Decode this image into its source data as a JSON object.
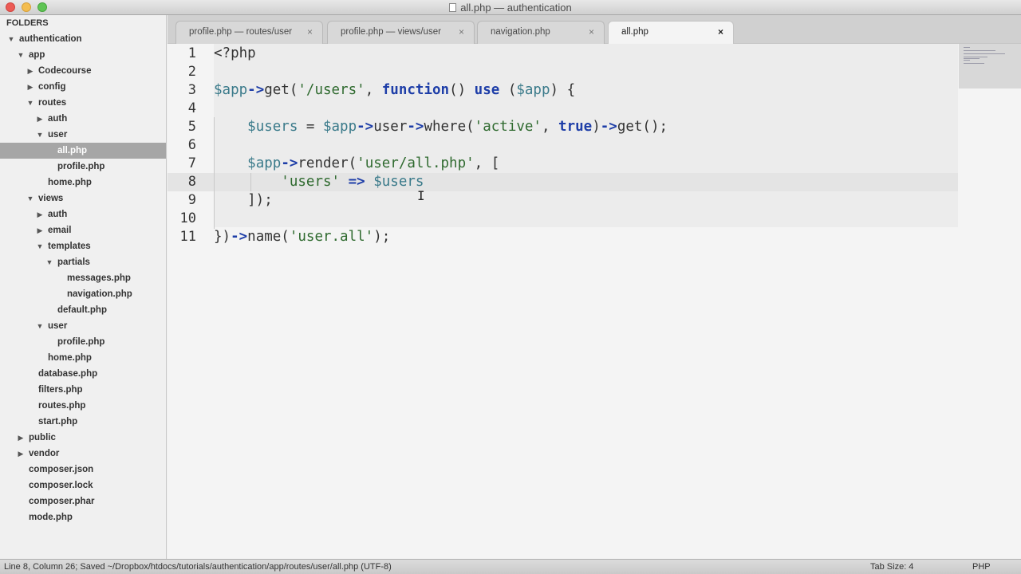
{
  "window": {
    "title": "all.php — authentication"
  },
  "sidebar": {
    "header": "FOLDERS",
    "items": [
      {
        "label": "authentication",
        "depth": 0,
        "arrow": "▼"
      },
      {
        "label": "app",
        "depth": 1,
        "arrow": "▼"
      },
      {
        "label": "Codecourse",
        "depth": 2,
        "arrow": "▶"
      },
      {
        "label": "config",
        "depth": 2,
        "arrow": "▶"
      },
      {
        "label": "routes",
        "depth": 2,
        "arrow": "▼"
      },
      {
        "label": "auth",
        "depth": 3,
        "arrow": "▶"
      },
      {
        "label": "user",
        "depth": 3,
        "arrow": "▼"
      },
      {
        "label": "all.php",
        "depth": 4,
        "arrow": "",
        "selected": true
      },
      {
        "label": "profile.php",
        "depth": 4,
        "arrow": ""
      },
      {
        "label": "home.php",
        "depth": 3,
        "arrow": ""
      },
      {
        "label": "views",
        "depth": 2,
        "arrow": "▼"
      },
      {
        "label": "auth",
        "depth": 3,
        "arrow": "▶"
      },
      {
        "label": "email",
        "depth": 3,
        "arrow": "▶"
      },
      {
        "label": "templates",
        "depth": 3,
        "arrow": "▼"
      },
      {
        "label": "partials",
        "depth": 4,
        "arrow": "▼"
      },
      {
        "label": "messages.php",
        "depth": 5,
        "arrow": ""
      },
      {
        "label": "navigation.php",
        "depth": 5,
        "arrow": ""
      },
      {
        "label": "default.php",
        "depth": 4,
        "arrow": ""
      },
      {
        "label": "user",
        "depth": 3,
        "arrow": "▼"
      },
      {
        "label": "profile.php",
        "depth": 4,
        "arrow": ""
      },
      {
        "label": "home.php",
        "depth": 3,
        "arrow": ""
      },
      {
        "label": "database.php",
        "depth": 2,
        "arrow": ""
      },
      {
        "label": "filters.php",
        "depth": 2,
        "arrow": ""
      },
      {
        "label": "routes.php",
        "depth": 2,
        "arrow": ""
      },
      {
        "label": "start.php",
        "depth": 2,
        "arrow": ""
      },
      {
        "label": "public",
        "depth": 1,
        "arrow": "▶"
      },
      {
        "label": "vendor",
        "depth": 1,
        "arrow": "▶"
      },
      {
        "label": "composer.json",
        "depth": 1,
        "arrow": ""
      },
      {
        "label": "composer.lock",
        "depth": 1,
        "arrow": ""
      },
      {
        "label": "composer.phar",
        "depth": 1,
        "arrow": ""
      },
      {
        "label": "mode.php",
        "depth": 1,
        "arrow": ""
      }
    ]
  },
  "tabs": [
    {
      "label": "profile.php — routes/user",
      "close": "×",
      "active": false
    },
    {
      "label": "profile.php — views/user",
      "close": "×",
      "active": false
    },
    {
      "label": "navigation.php",
      "close": "×",
      "active": false
    },
    {
      "label": "all.php",
      "close": "×",
      "active": true
    }
  ],
  "editor": {
    "line_numbers": [
      "1",
      "2",
      "3",
      "4",
      "5",
      "6",
      "7",
      "8",
      "9",
      "10",
      "11"
    ],
    "lines": [
      [
        {
          "t": "<?php",
          "c": "fn"
        }
      ],
      [],
      [
        {
          "t": "$app",
          "c": "var"
        },
        {
          "t": "->",
          "c": "op"
        },
        {
          "t": "get(",
          "c": "fn"
        },
        {
          "t": "'/users'",
          "c": "str"
        },
        {
          "t": ", ",
          "c": "fn"
        },
        {
          "t": "function",
          "c": "kw"
        },
        {
          "t": "() ",
          "c": "fn"
        },
        {
          "t": "use",
          "c": "kw"
        },
        {
          "t": " (",
          "c": "fn"
        },
        {
          "t": "$app",
          "c": "var"
        },
        {
          "t": ") {",
          "c": "fn"
        }
      ],
      [],
      [
        {
          "t": "    ",
          "c": "fn"
        },
        {
          "t": "$users",
          "c": "var"
        },
        {
          "t": " = ",
          "c": "fn"
        },
        {
          "t": "$app",
          "c": "var"
        },
        {
          "t": "->",
          "c": "op"
        },
        {
          "t": "user",
          "c": "fn"
        },
        {
          "t": "->",
          "c": "op"
        },
        {
          "t": "where(",
          "c": "fn"
        },
        {
          "t": "'active'",
          "c": "str"
        },
        {
          "t": ", ",
          "c": "fn"
        },
        {
          "t": "true",
          "c": "kw"
        },
        {
          "t": ")",
          "c": "fn"
        },
        {
          "t": "->",
          "c": "op"
        },
        {
          "t": "get();",
          "c": "fn"
        }
      ],
      [],
      [
        {
          "t": "    ",
          "c": "fn"
        },
        {
          "t": "$app",
          "c": "var"
        },
        {
          "t": "->",
          "c": "op"
        },
        {
          "t": "render(",
          "c": "fn"
        },
        {
          "t": "'user/all.php'",
          "c": "str"
        },
        {
          "t": ", [",
          "c": "fn"
        }
      ],
      [
        {
          "t": "        ",
          "c": "fn"
        },
        {
          "t": "'users'",
          "c": "str"
        },
        {
          "t": " ",
          "c": "fn"
        },
        {
          "t": "=>",
          "c": "op"
        },
        {
          "t": " ",
          "c": "fn"
        },
        {
          "t": "$users",
          "c": "var"
        }
      ],
      [
        {
          "t": "    ]);",
          "c": "fn"
        }
      ],
      [],
      [
        {
          "t": "})",
          "c": "fn"
        },
        {
          "t": "->",
          "c": "op"
        },
        {
          "t": "name(",
          "c": "fn"
        },
        {
          "t": "'user.all'",
          "c": "str"
        },
        {
          "t": ");",
          "c": "fn"
        }
      ]
    ]
  },
  "status": {
    "left": "Line 8, Column 26; Saved ~/Dropbox/htdocs/tutorials/authentication/app/routes/user/all.php (UTF-8)",
    "tab_size": "Tab Size: 4",
    "syntax": "PHP"
  }
}
